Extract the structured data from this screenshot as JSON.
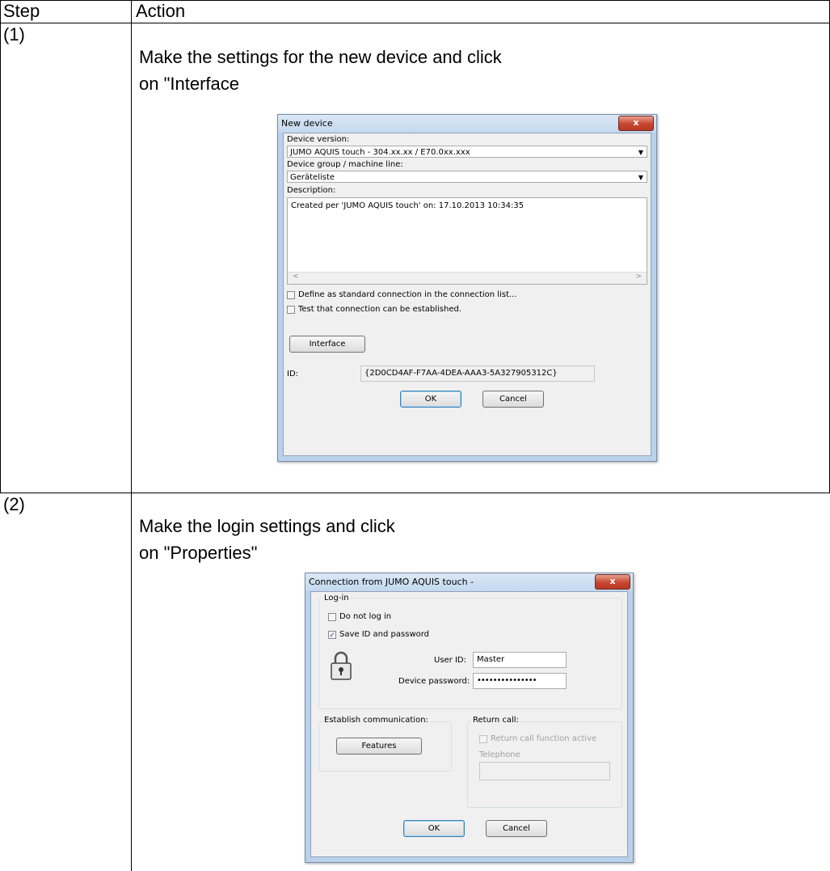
{
  "table": {
    "headers": {
      "step": "Step",
      "action": "Action"
    },
    "rows": [
      {
        "step": "(1)",
        "action_line1": "Make the settings for the new device and click",
        "action_line2": "on \"Interface"
      },
      {
        "step": "(2)",
        "action_line1": "Make the login settings and click",
        "action_line2": "on \"Properties\""
      }
    ]
  },
  "dialog1": {
    "title": "New device",
    "close_glyph": "x",
    "device_version_label": "Device version:",
    "device_version_value": "JUMO AQUIS touch  -  304.xx.xx / E70.0xx.xxx",
    "device_group_label": "Device group / machine line:",
    "device_group_value": "Geräteliste",
    "description_label": "Description:",
    "description_value": "Created per 'JUMO AQUIS touch' on: 17.10.2013 10:34:35",
    "scroll_left": "<",
    "scroll_right": ">",
    "checkbox_standard_label": "Define as standard connection in the connection list...",
    "checkbox_test_label": "Test that connection can be established.",
    "interface_button": "Interface",
    "id_label": "ID:",
    "id_value": "{2D0CD4AF-F7AA-4DEA-AAA3-5A327905312C}",
    "ok_button": "OK",
    "cancel_button": "Cancel",
    "dropdown_arrow": "▼"
  },
  "dialog2": {
    "title": "Connection from JUMO AQUIS touch -",
    "close_glyph": "x",
    "login_group_label": "Log-in",
    "do_not_log_in_label": "Do not log in",
    "save_id_label": "Save ID and password",
    "save_id_check": "✓",
    "user_id_label": "User ID:",
    "user_id_value": "Master",
    "password_label": "Device password:",
    "password_value": "•••••••••••••••",
    "establish_label": "Establish communication:",
    "features_button": "Features",
    "return_call_label": "Return call:",
    "return_call_active_label": "Return call function active",
    "telephone_label": "Telephone",
    "ok_button": "OK",
    "cancel_button": "Cancel"
  }
}
